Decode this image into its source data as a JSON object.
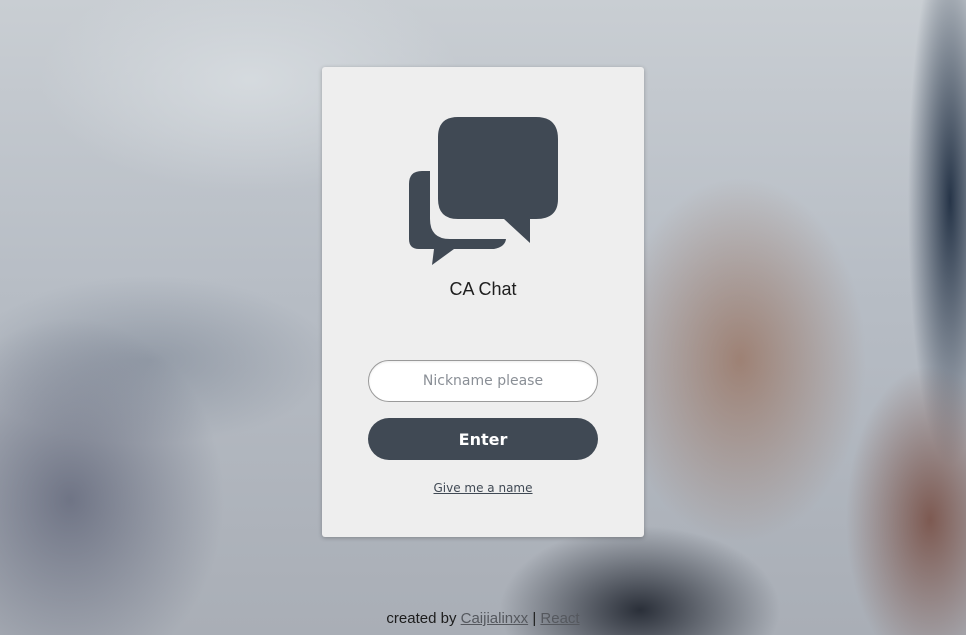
{
  "app": {
    "title": "CA Chat",
    "logo_icon": "chat-bubbles-icon",
    "icon_color": "#404954",
    "card_color": "#eeeeee"
  },
  "form": {
    "nickname_placeholder": "Nickname please",
    "nickname_value": "",
    "enter_label": "Enter",
    "random_name_link": "Give me a name"
  },
  "footer": {
    "created_by": "created by",
    "author_link": "Caijialinxx",
    "separator": "|",
    "framework_link": "React"
  }
}
